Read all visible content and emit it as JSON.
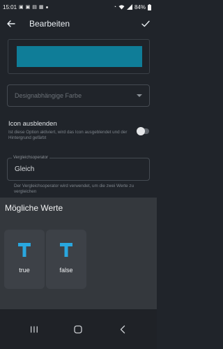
{
  "status": {
    "time": "15:01",
    "icons_left": [
      "image-icon",
      "image-icon",
      "lock-icon",
      "calendar-icon",
      "dot-icon"
    ],
    "icons_right": [
      "alarm-icon",
      "wifi-icon",
      "signal-icon"
    ],
    "battery": "84%"
  },
  "appbar": {
    "title": "Bearbeiten"
  },
  "color": {
    "swatch": "#0f7d98"
  },
  "design_select": {
    "placeholder": "Designabhängige Farbe"
  },
  "hide_icon": {
    "title": "Icon ausblenden",
    "description": "Ist diese Option aktiviert, wird das Icon ausgeblendet und der Hintergrund gefärbt",
    "enabled": false
  },
  "operator": {
    "label": "Vergleichsoperator",
    "value": "Gleich",
    "help": "Der Vergleichsoperator wird verwendet, um die zwei Werte zu vergleichen"
  },
  "sheet": {
    "title": "Mögliche Werte",
    "options": [
      {
        "label": "true",
        "icon": "text-t-icon"
      },
      {
        "label": "false",
        "icon": "text-t-icon"
      }
    ],
    "accent": "#29a7df"
  },
  "nav": {
    "buttons": [
      "recents-icon",
      "home-icon",
      "back-icon"
    ]
  }
}
